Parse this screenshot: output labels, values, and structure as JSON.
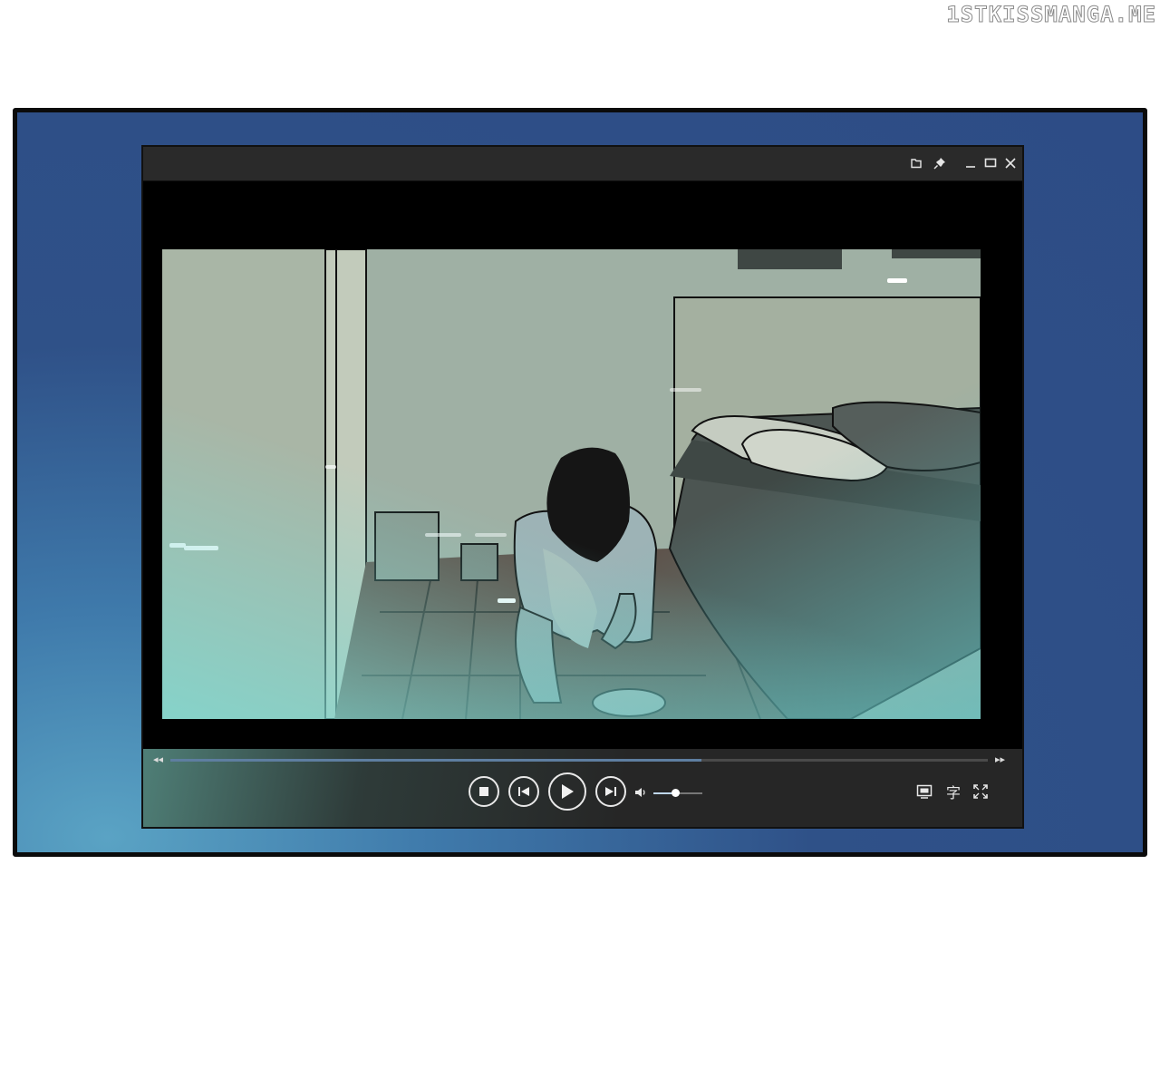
{
  "watermark": {
    "text": "1STKISSMANGA.ME"
  },
  "player": {
    "titlebar_icons": [
      "folder-icon",
      "pin-icon",
      "minimize-icon",
      "maximize-icon",
      "close-icon"
    ],
    "progress": {
      "played_fraction": 0.65
    },
    "volume": {
      "level_fraction": 0.45
    },
    "controls": [
      "stop-icon",
      "previous-track-icon",
      "play-icon",
      "next-track-icon",
      "volume-icon"
    ],
    "right_controls": {
      "subtitle_label": "字",
      "icons": [
        "screen-mode-icon",
        "subtitle-icon",
        "fullscreen-icon"
      ]
    }
  },
  "colors": {
    "frame_border": "#0b0b0b",
    "frame_bg": "#2d4c86",
    "player_chrome": "#2a2a2a",
    "accent": "#5e7ea0"
  }
}
